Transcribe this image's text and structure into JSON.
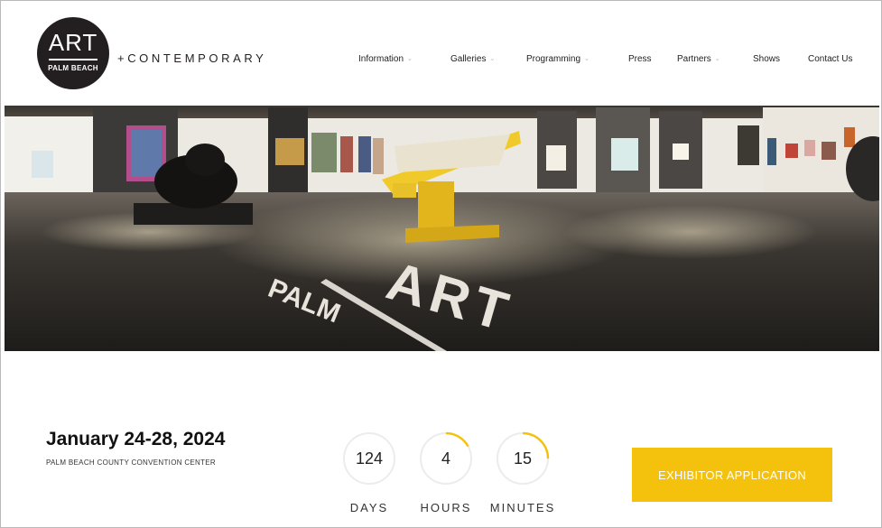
{
  "brand": {
    "logo_title": "ART",
    "logo_subtitle": "PALM BEACH",
    "tagline": "+CONTEMPORARY"
  },
  "nav": {
    "items": [
      {
        "label": "Information",
        "has_dropdown": true
      },
      {
        "label": "Galleries",
        "has_dropdown": true
      },
      {
        "label": "Programming",
        "has_dropdown": true
      },
      {
        "label": "Press",
        "has_dropdown": false
      },
      {
        "label": "Partners",
        "has_dropdown": true
      },
      {
        "label": "Shows",
        "has_dropdown": false
      },
      {
        "label": "Contact Us",
        "has_dropdown": false
      }
    ],
    "dropdown_glyph": "⌄"
  },
  "hero": {
    "floor_text_1": "PALM",
    "floor_text_2": "ART"
  },
  "event": {
    "dates": "January 24-28, 2024",
    "venue": "PALM BEACH COUNTY CONVENTION CENTER"
  },
  "countdown": [
    {
      "value": "124",
      "unit": "DAYS",
      "progress": 0.0
    },
    {
      "value": "4",
      "unit": "HOURS",
      "progress": 0.17
    },
    {
      "value": "15",
      "unit": "MINUTES",
      "progress": 0.25
    }
  ],
  "cta": {
    "label": "EXHIBITOR APPLICATION"
  },
  "colors": {
    "accent": "#f4c20d",
    "ring_track": "#ececec",
    "logo_bg": "#231f20"
  }
}
